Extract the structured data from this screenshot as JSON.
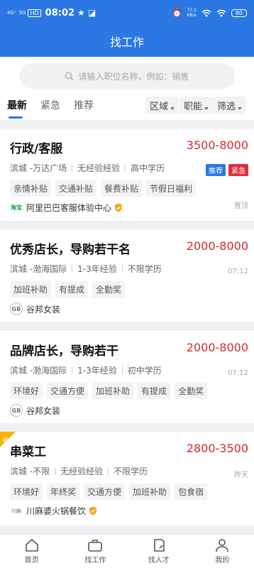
{
  "status_bar": {
    "signal_1": "4G⁺",
    "signal_2": "5G",
    "hd": "HD",
    "time": "08:02",
    "speed_value": "77.1",
    "speed_unit": "KB/s",
    "battery": "80"
  },
  "header": {
    "title": "找工作"
  },
  "search": {
    "placeholder": "请输入职位名称，例如：销售"
  },
  "tabs": [
    {
      "label": "最新",
      "active": true
    },
    {
      "label": "紧急",
      "active": false
    },
    {
      "label": "推荐",
      "active": false
    }
  ],
  "filters": [
    {
      "label": "区域"
    },
    {
      "label": "职能"
    },
    {
      "label": "筛选"
    }
  ],
  "jobs": [
    {
      "title": "行政/客服",
      "salary": "3500-8000",
      "location": "滨城 -万达广场",
      "experience": "无经验经验",
      "education": "高中学历",
      "tags": [
        "亲情补贴",
        "交通补贴",
        "餐费补贴",
        "节假日福利"
      ],
      "company": "阿里巴巴客服体验中心",
      "company_logo_text": "淘宝",
      "verified": true,
      "right_label": "置顶",
      "badges": [
        {
          "text": "推荐",
          "color": "#2b78e4"
        },
        {
          "text": "紧急",
          "color": "#e02e3a"
        }
      ]
    },
    {
      "title": "优秀店长，导购若干名",
      "salary": "2000-8000",
      "location": "滨城 -渤海国际",
      "experience": "1-3年经验",
      "education": "不限学历",
      "tags": [
        "加班补助",
        "有提成",
        "全勤奖"
      ],
      "company": "谷邦女装",
      "company_logo_text": "GB",
      "verified": false,
      "right_label": "07:12"
    },
    {
      "title": "品牌店长，导购若干",
      "salary": "2000-8000",
      "location": "滨城 -渤海国际",
      "experience": "1-3年经验",
      "education": "初中学历",
      "tags": [
        "环境好",
        "交通方便",
        "加班补助",
        "有提成",
        "全勤奖"
      ],
      "company": "谷邦女装",
      "company_logo_text": "GB",
      "verified": false,
      "right_label": "07:12"
    },
    {
      "title": "串菜工",
      "salary": "2800-3500",
      "location": "滨城 -不限",
      "experience": "无经验经验",
      "education": "不限学历",
      "tags": [
        "环境好",
        "年终奖",
        "交通方便",
        "加班补助",
        "包食宿"
      ],
      "company": "川麻婆火锅餐饮",
      "company_logo_text": "川麻",
      "verified": true,
      "right_label": "昨天",
      "new_label": "新"
    }
  ],
  "bottom_nav": [
    {
      "label": "首页",
      "icon": "home-icon"
    },
    {
      "label": "找工作",
      "icon": "briefcase-icon"
    },
    {
      "label": "找人才",
      "icon": "document-icon"
    },
    {
      "label": "我的",
      "icon": "user-icon"
    }
  ]
}
